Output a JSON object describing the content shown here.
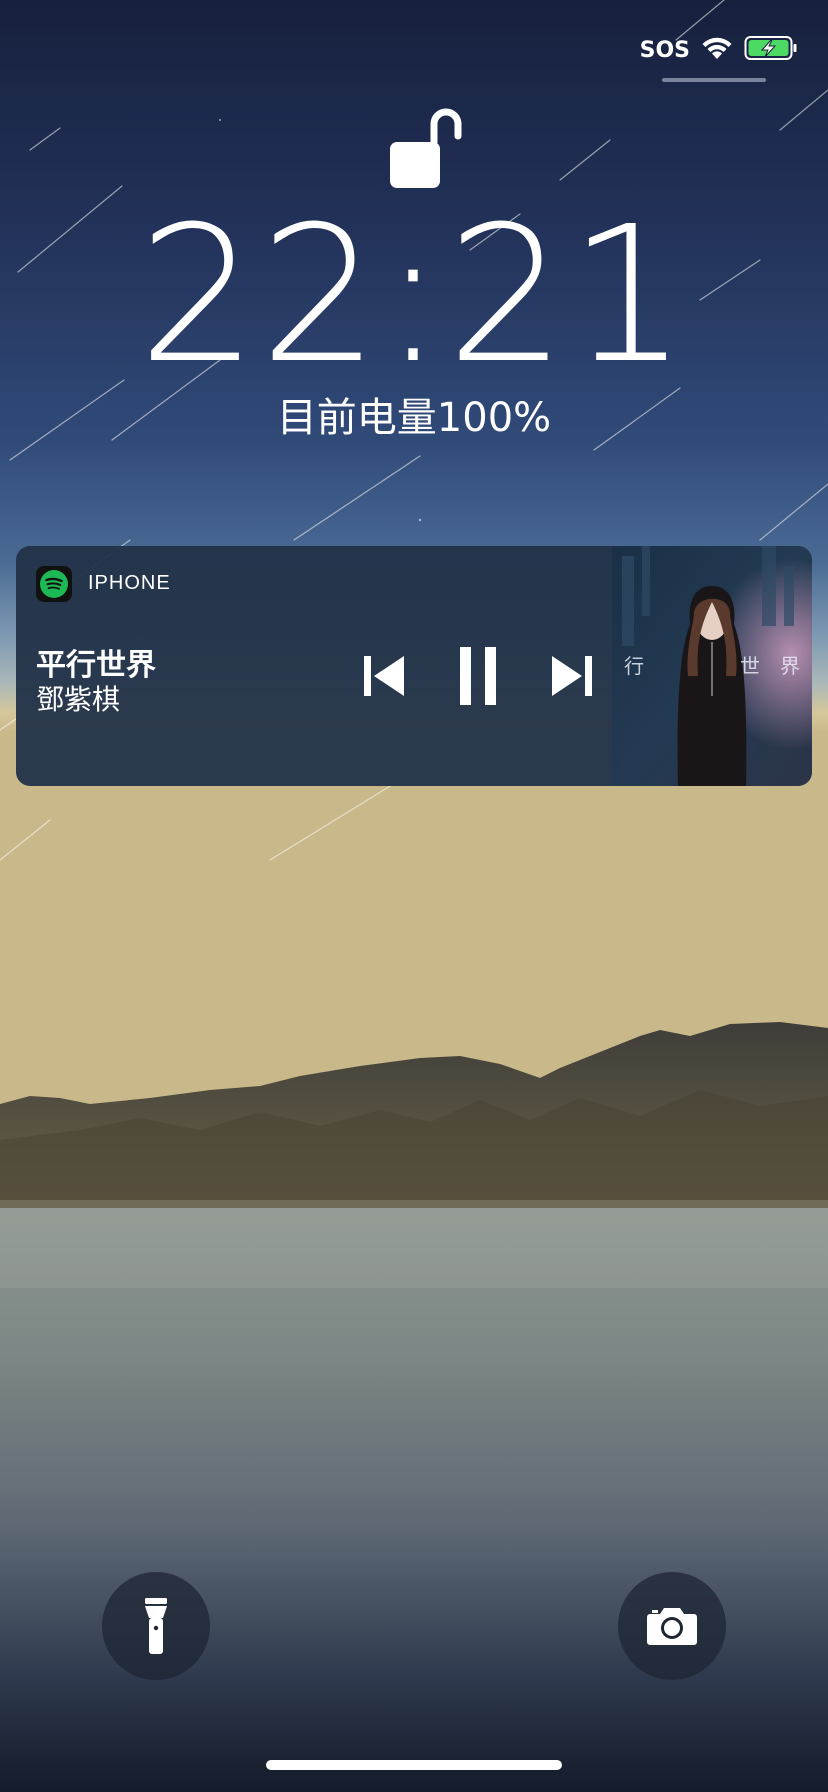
{
  "status_bar": {
    "sos_label": "SOS",
    "wifi_icon": "wifi-icon",
    "battery_icon": "battery-charging-icon",
    "battery_color": "#4cd964"
  },
  "lock": {
    "icon": "unlocked-padlock-icon"
  },
  "clock": {
    "time": "22:21",
    "battery_status": "目前电量100%"
  },
  "now_playing": {
    "source": "IPHONE",
    "app_icon": "spotify-icon",
    "app_color": "#1db954",
    "track_title": "平行世界",
    "artist": "鄧紫棋",
    "controls": {
      "previous_icon": "previous-track-icon",
      "pause_icon": "pause-icon",
      "next_icon": "next-track-icon"
    },
    "album_art_text": {
      "left": "行",
      "right": "世　界"
    }
  },
  "quick_actions": {
    "flashlight_icon": "flashlight-icon",
    "camera_icon": "camera-icon"
  }
}
